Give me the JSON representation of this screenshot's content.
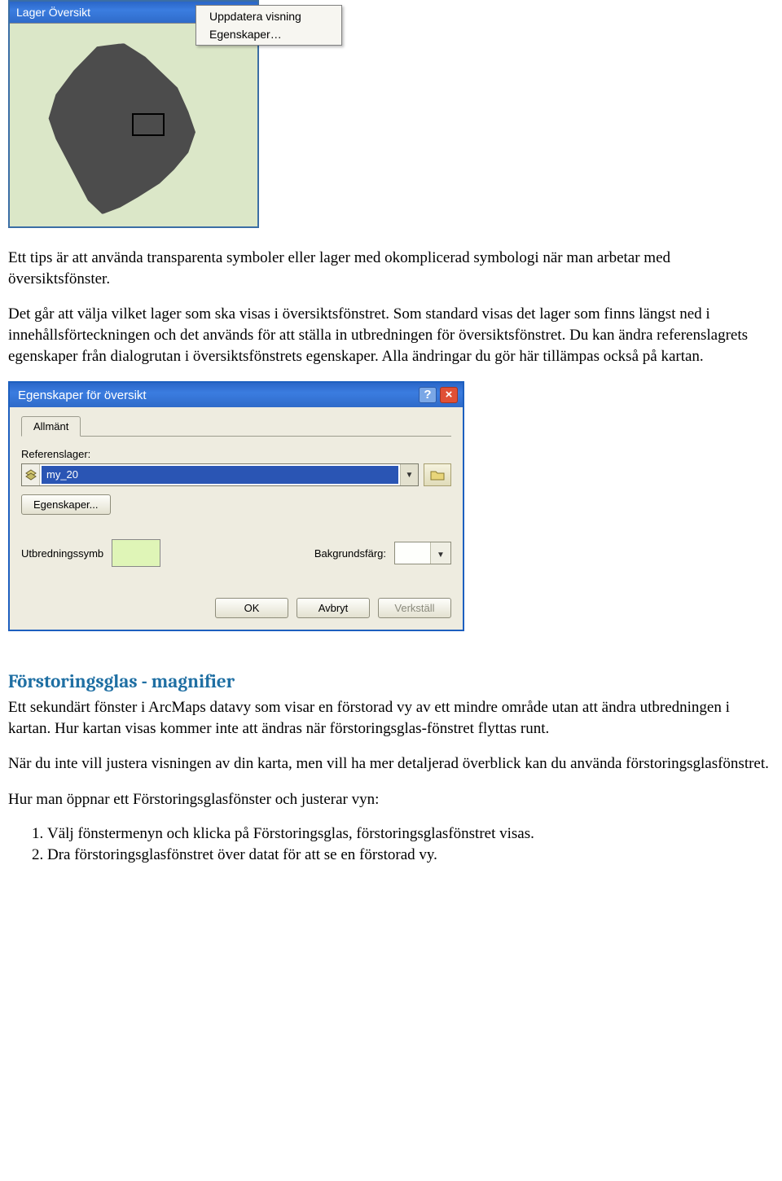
{
  "panel1": {
    "title": "Lager Översikt",
    "menu": {
      "item1": "Uppdatera visning",
      "item2": "Egenskaper…"
    }
  },
  "p1": "Ett tips är att använda transparenta symboler eller lager med okomplicerad symbologi när man arbetar med översiktsfönster.",
  "p2": "Det går att välja vilket lager som ska visas i översiktsfönstret. Som standard visas det lager som finns längst ned i innehållsförteckningen och det används för att ställa in utbredningen för översiktsfönstret. Du kan ändra referenslagrets egenskaper från dialogrutan i översiktsfönstrets egenskaper. Alla ändringar du gör här tillämpas också på kartan.",
  "dialog": {
    "title": "Egenskaper för översikt",
    "tab": "Allmänt",
    "ref_label": "Referenslager:",
    "ref_value": "my_20",
    "props_btn": "Egenskaper...",
    "ext_label": "Utbredningssymb",
    "bg_label": "Bakgrundsfärg:",
    "ok": "OK",
    "cancel": "Avbryt",
    "apply": "Verkställ"
  },
  "section_heading": "Förstoringsglas - magnifier",
  "p3": "Ett sekundärt fönster i ArcMaps datavy som visar en förstorad vy av ett mindre område utan att ändra utbredningen i kartan. Hur kartan visas kommer inte att ändras när förstoringsglas-fönstret flyttas runt.",
  "p4": "När du inte vill justera visningen av din karta, men vill ha mer detaljerad överblick kan du använda förstoringsglasfönstret.",
  "p5": "Hur man öppnar ett Förstoringsglasfönster och justerar vyn:",
  "steps": {
    "s1": "Välj fönstermenyn och klicka på Förstoringsglas, förstoringsglasfönstret visas.",
    "s2": "Dra förstoringsglasfönstret över datat för att se en förstorad vy."
  }
}
